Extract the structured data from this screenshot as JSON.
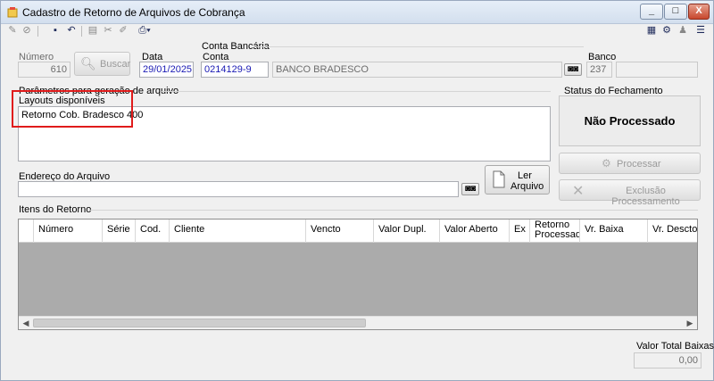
{
  "window": {
    "title": "Cadastro de Retorno de Arquivos de Cobrança",
    "min_icon": "minimize-icon",
    "max_icon": "maximize-icon",
    "close_icon": "close-icon"
  },
  "toolbar": {
    "new_glyph": "✎",
    "cancel_glyph": "⊘",
    "save_glyph": "▪",
    "undo_glyph": "↶",
    "copy_glyph": "▤",
    "tools_glyph": "✂",
    "clear_glyph": "✐",
    "print_glyph": "⎙▾",
    "right1_glyph": "▦",
    "right2_glyph": "⚙",
    "right3_glyph": "♟",
    "right4_glyph": "☰"
  },
  "form": {
    "numero_label": "Número",
    "numero_value": "610",
    "buscar_label": "Buscar",
    "data_label": "Data",
    "data_value": "29/01/2025",
    "conta_bancaria_label": "Conta Bancária",
    "conta_label": "Conta",
    "conta_value": "0214129-9",
    "banco_nome": "BANCO BRADESCO",
    "banco_label": "Banco",
    "banco_value": "237",
    "parametros_label": "Parâmetros para geração de arquivo",
    "layouts_label": "Layouts disponíveis",
    "layout_item": "Retorno Cob. Bradesco 400",
    "endereco_label": "Endereço do Arquivo",
    "endereco_value": "",
    "ler_arquivo_line1": "Ler",
    "ler_arquivo_line2": "Arquivo"
  },
  "status": {
    "group_label": "Status do Fechamento",
    "value": "Não Processado",
    "processar_label": "Processar",
    "exclusao_label": "Exclusão Processamento"
  },
  "itens": {
    "group_label": "Itens do Retorno",
    "columns": [
      "Número",
      "Série",
      "Cod.",
      "Cliente",
      "Vencto",
      "Valor Dupl.",
      "Valor Aberto",
      "Ex",
      "Retorno",
      "Processado",
      "Vr. Baixa",
      "Vr. Descto"
    ]
  },
  "totals": {
    "label": "Valor Total Baixas",
    "value": "0,00"
  }
}
